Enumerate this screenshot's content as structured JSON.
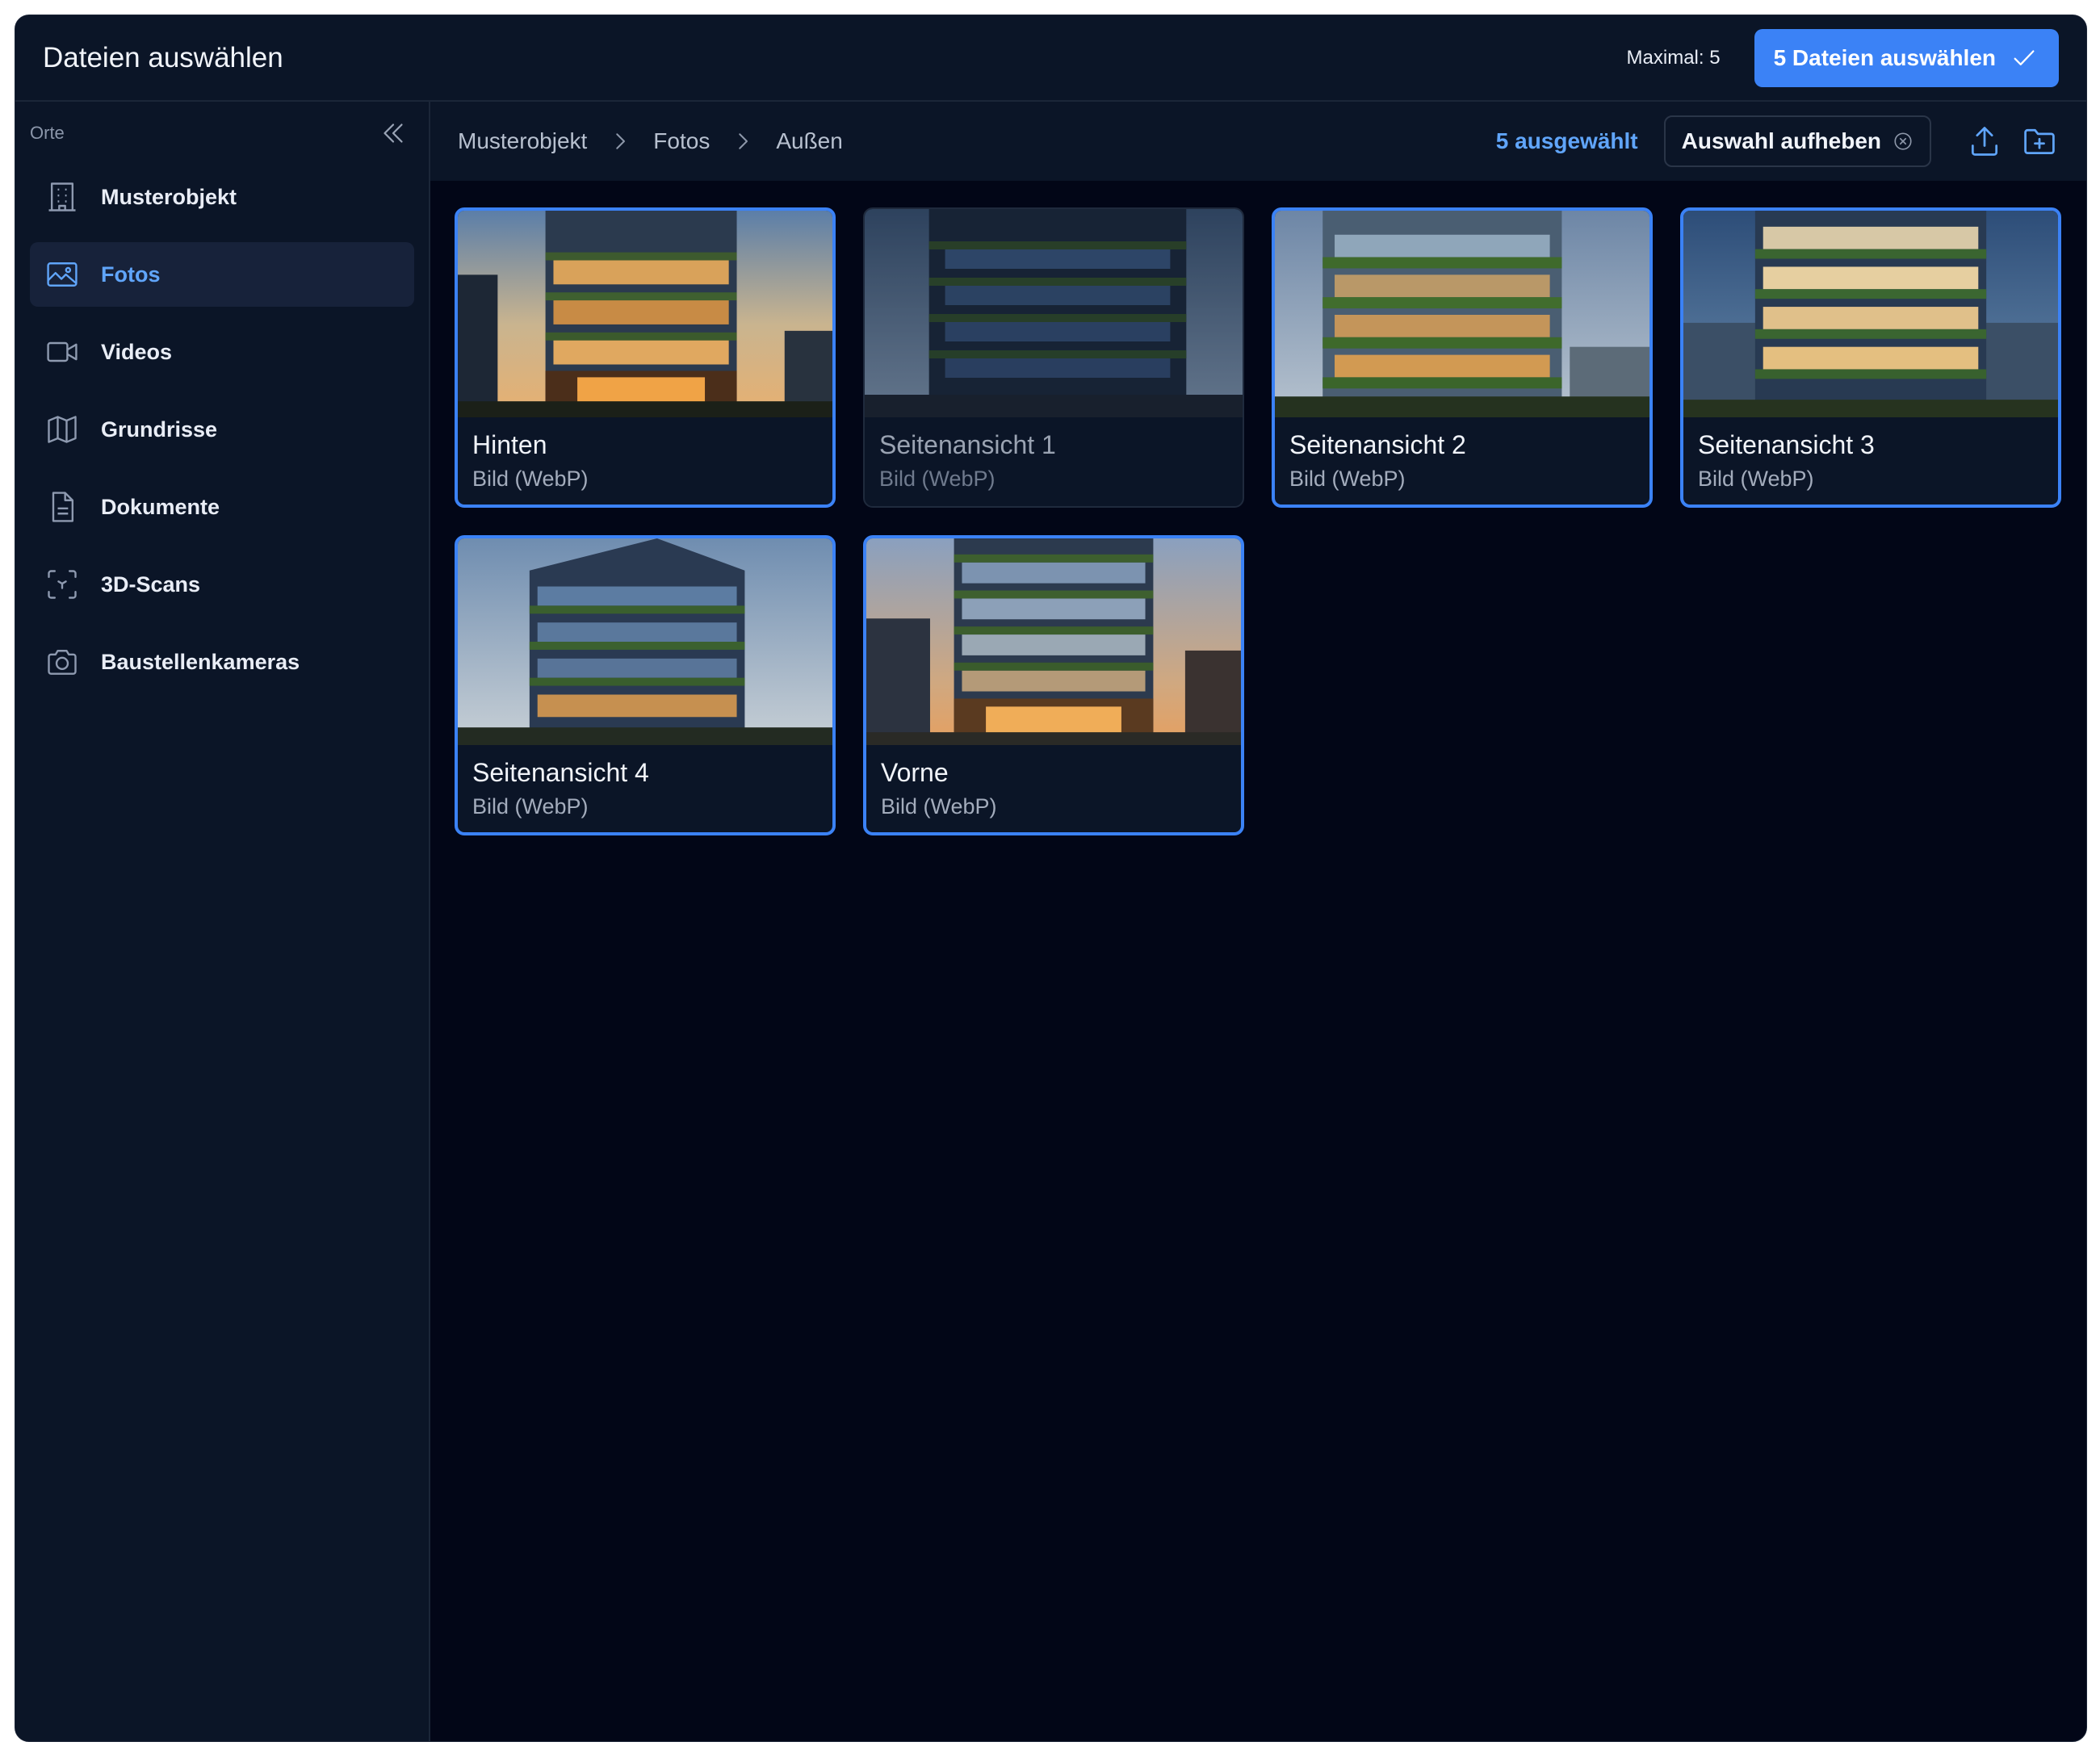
{
  "header": {
    "title": "Dateien auswählen",
    "max_label": "Maximal: 5",
    "confirm_label": "5 Dateien auswählen"
  },
  "sidebar": {
    "section_label": "Orte",
    "items": [
      {
        "label": "Musterobjekt",
        "icon": "building-icon"
      },
      {
        "label": "Fotos",
        "icon": "image-icon",
        "active": true
      },
      {
        "label": "Videos",
        "icon": "video-icon"
      },
      {
        "label": "Grundrisse",
        "icon": "map-icon"
      },
      {
        "label": "Dokumente",
        "icon": "document-icon"
      },
      {
        "label": "3D-Scans",
        "icon": "scan-3d-icon"
      },
      {
        "label": "Baustellenkameras",
        "icon": "camera-icon"
      }
    ]
  },
  "toolbar": {
    "breadcrumb": [
      "Musterobjekt",
      "Fotos",
      "Außen"
    ],
    "selected_count": "5 ausgewählt",
    "clear_selection": "Auswahl aufheben"
  },
  "files": [
    {
      "name": "Hinten",
      "type": "Bild (WebP)",
      "selected": true
    },
    {
      "name": "Seitenansicht 1",
      "type": "Bild (WebP)",
      "selected": false
    },
    {
      "name": "Seitenansicht 2",
      "type": "Bild (WebP)",
      "selected": true
    },
    {
      "name": "Seitenansicht 3",
      "type": "Bild (WebP)",
      "selected": true
    },
    {
      "name": "Seitenansicht 4",
      "type": "Bild (WebP)",
      "selected": true
    },
    {
      "name": "Vorne",
      "type": "Bild (WebP)",
      "selected": true
    }
  ],
  "colors": {
    "accent": "#3b82f6",
    "accent_text": "#60a5fa",
    "background": "#020617",
    "panel": "#0b1527"
  }
}
